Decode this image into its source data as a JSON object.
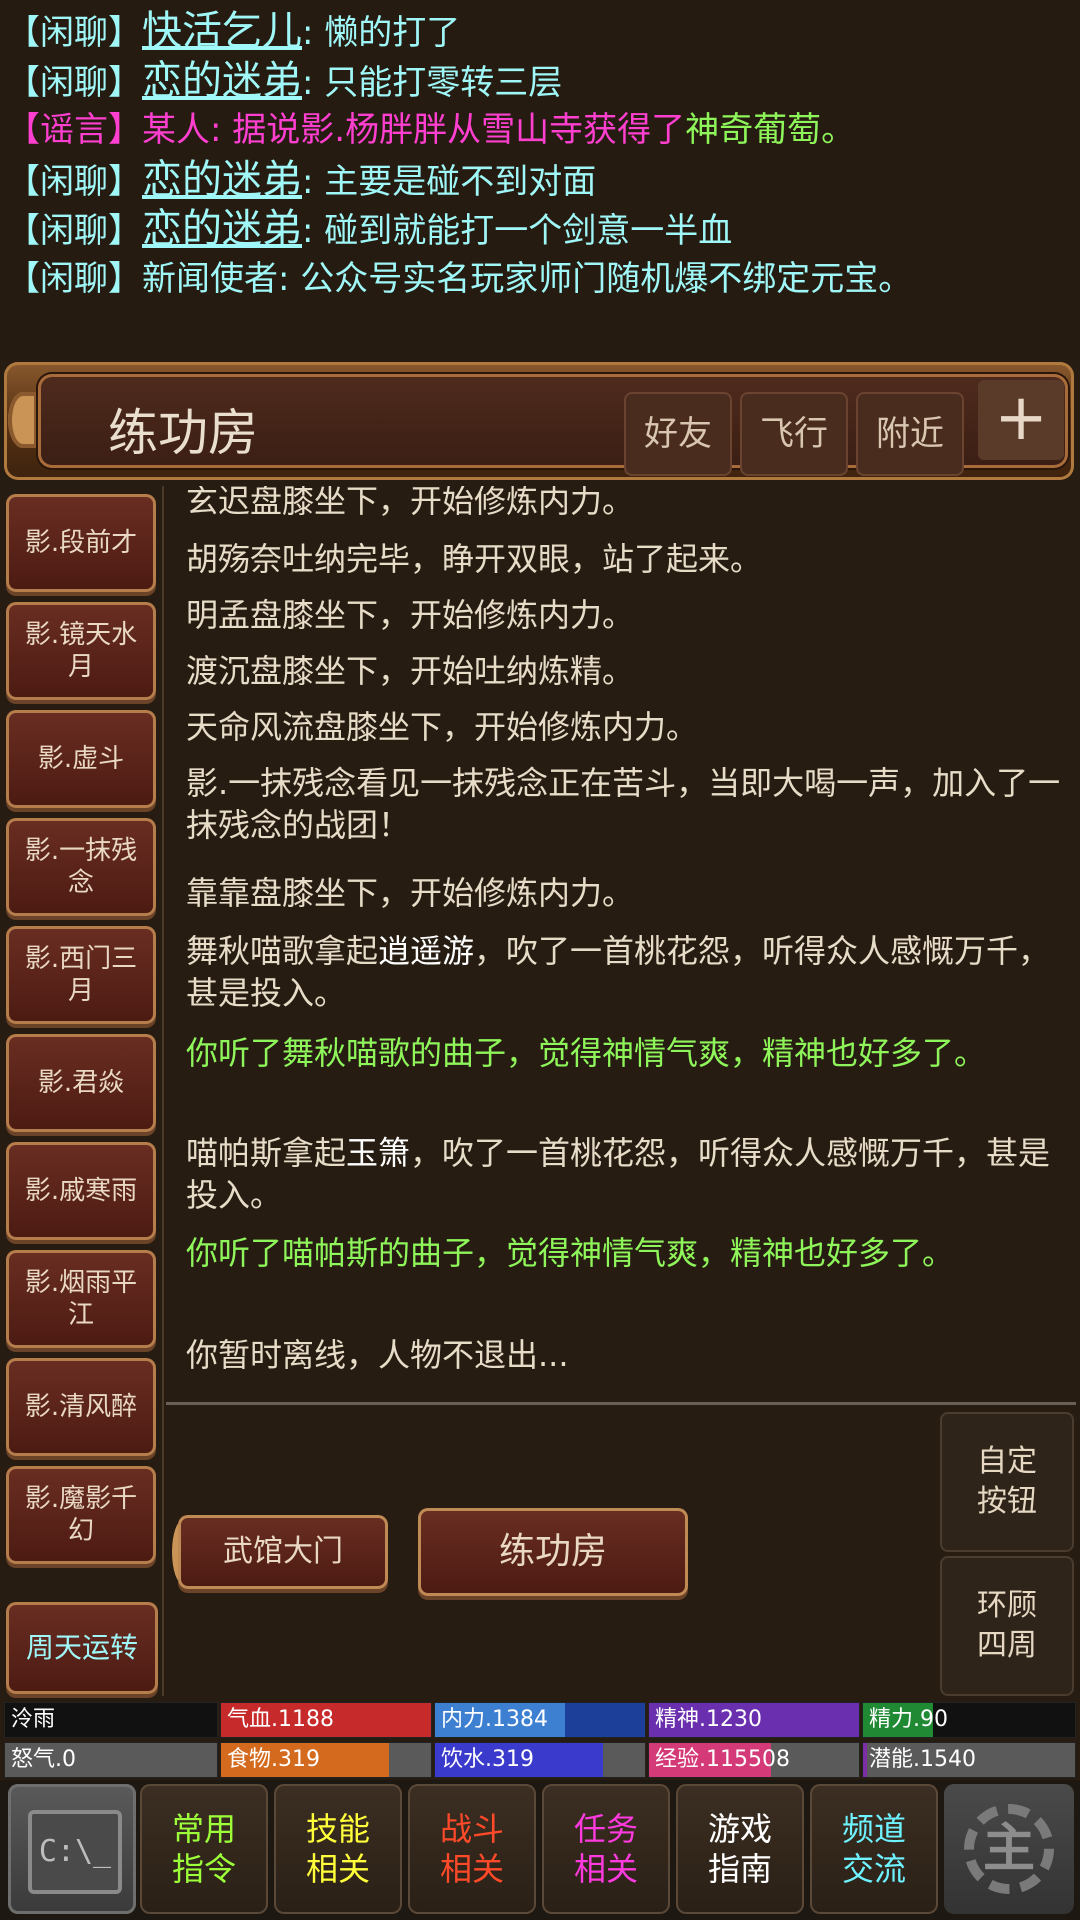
{
  "chat": [
    {
      "tag": "【闲聊】",
      "name": "快活乞儿",
      "text": ": 懒的打了"
    },
    {
      "tag": "【闲聊】",
      "name": "恋的迷弟",
      "text": ": 只能打零转三层"
    },
    {
      "tag": "【谣言】",
      "name": "某人",
      "text": ": 据说影.杨胖胖从雪山寺获得了",
      "item": "神奇葡萄。"
    },
    {
      "tag": "【闲聊】",
      "name": "恋的迷弟",
      "text": ": 主要是碰不到对面"
    },
    {
      "tag": "【闲聊】",
      "name": "恋的迷弟",
      "text": ": 碰到就能打一个剑意一半血"
    },
    {
      "tag": "【闲聊】",
      "name": "新闻使者",
      "text": ": 公众号实名玩家师门随机爆不绑定元宝。"
    }
  ],
  "room": {
    "title": "练功房",
    "buttons": [
      "好友",
      "飞行",
      "附近",
      "+"
    ]
  },
  "npcs": [
    "影.段前才",
    "影.镜天水月",
    "影.虚斗",
    "影.一抹残念",
    "影.西门三月",
    "影.君焱",
    "影.戚寒雨",
    "影.烟雨平江",
    "影.清风醉",
    "影.魔影千幻"
  ],
  "zhoutian_label": "周天运转",
  "log": [
    {
      "text": "玄迟盘膝坐下，开始修炼内力。"
    },
    {
      "text": "胡殇奈吐纳完毕，睁开双眼，站了起来。"
    },
    {
      "text": "明孟盘膝坐下，开始修炼内力。"
    },
    {
      "text": "渡沉盘膝坐下，开始吐纳炼精。"
    },
    {
      "text": "天命风流盘膝坐下，开始修炼内力。"
    },
    {
      "text": "影.一抹残念看见一抹残念正在苦斗，当即大喝一声，加入了一抹残念的战团！"
    },
    {
      "text": "靠靠盘膝坐下，开始修炼内力。"
    },
    {
      "pre": "舞秋喵歌拿起",
      "hl": "逍遥游",
      "post": "，吹了一首桃花怨，听得众人感慨万千，甚是投入。"
    },
    {
      "text": "你听了舞秋喵歌的曲子，觉得神情气爽，精神也好多了。",
      "green": true
    },
    {
      "pre": "喵帕斯拿起",
      "hl": "玉箫",
      "post": "，吹了一首桃花怨，听得众人感慨万千，甚是投入。"
    },
    {
      "text": "你听了喵帕斯的曲子，觉得神情气爽，精神也好多了。",
      "green": true
    },
    {
      "text": "你暂时离线，人物不退出..."
    }
  ],
  "exits": {
    "west": "武馆大门",
    "center": "练功房"
  },
  "side_buttons": [
    "自定\n按钮",
    "环顾\n四周"
  ],
  "stats": [
    {
      "label": "泠雨",
      "fill": 0.0,
      "color": "#000000",
      "bg": "#111111"
    },
    {
      "label": "气血.1188",
      "fill": 1.0,
      "color": "#c62a2a",
      "bg": "#5a5a5a"
    },
    {
      "label": "内力.1384",
      "fill": 0.62,
      "color": "#3d7fd0",
      "bg": "#1c3f9a",
      "fill2": 0.92
    },
    {
      "label": "精神.1230",
      "fill": 1.0,
      "color": "#6a2fae",
      "bg": "#5a5a5a"
    },
    {
      "label": "精力.90",
      "fill": 0.33,
      "color": "#1f8a33",
      "bg": "#111111"
    },
    {
      "label": "怒气.0",
      "fill": 0.0,
      "color": "#5a5a5a",
      "bg": "#5a5a5a"
    },
    {
      "label": "食物.319",
      "fill": 0.8,
      "color": "#d46a1e",
      "bg": "#5a5a5a"
    },
    {
      "label": "饮水.319",
      "fill": 0.8,
      "color": "#3a3acc",
      "bg": "#5a5a5a"
    },
    {
      "label": "经验.115508",
      "fill": 0.58,
      "color": "#d43a78",
      "bg": "#5a5a5a"
    },
    {
      "label": "潜能.1540",
      "fill": 0.02,
      "color": "#7a2fa8",
      "bg": "#5a5a5a"
    }
  ],
  "nav": [
    {
      "label": "常用\n指令",
      "color": "#9dff3a"
    },
    {
      "label": "技能\n相关",
      "color": "#ffff3a"
    },
    {
      "label": "战斗\n相关",
      "color": "#ff4a2a"
    },
    {
      "label": "任务\n相关",
      "color": "#ff3adf"
    },
    {
      "label": "游戏\n指南",
      "color": "#ffffff"
    },
    {
      "label": "频道\n交流",
      "color": "#6ff2ff"
    }
  ],
  "cmd_icon_text": "C:\\_",
  "gear_icon_text": "主"
}
